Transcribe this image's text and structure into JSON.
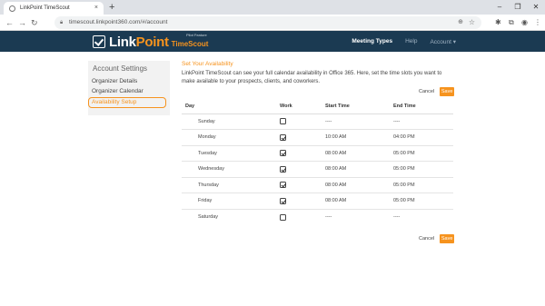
{
  "browser": {
    "tab_title": "LinkPoint TimeScout",
    "tab_close": "×",
    "new_tab": "+",
    "url": "timescout.linkpoint360.com/#/account",
    "window_controls": [
      "–",
      "❐",
      "✕"
    ]
  },
  "app": {
    "logo_main": "Link",
    "logo_accent": "Point",
    "logo_sub": "TimeScout",
    "logo_tag": "Pilot Feature",
    "nav": [
      "Meeting Types",
      "Help",
      "Account ▾"
    ]
  },
  "sidebar": {
    "title": "Account Settings",
    "items": [
      "Organizer Details",
      "Organizer Calendar",
      "Availability Setup"
    ]
  },
  "main": {
    "heading": "Set Your Availability",
    "description": "LinkPoint TimeScout can see your full calendar availability in Office 365. Here, set the time slots you want to make available to your prospects, clients, and coworkers.",
    "cancel_label": "Cancel",
    "save_label": "Save",
    "columns": [
      "Day",
      "Work",
      "Start Time",
      "End Time"
    ],
    "rows": [
      {
        "day": "Sunday",
        "work": false,
        "start": "----",
        "end": "----"
      },
      {
        "day": "Monday",
        "work": true,
        "start": "10:00 AM",
        "end": "04:00 PM"
      },
      {
        "day": "Tuesday",
        "work": true,
        "start": "08:00 AM",
        "end": "05:00 PM"
      },
      {
        "day": "Wednesday",
        "work": true,
        "start": "08:00 AM",
        "end": "05:00 PM"
      },
      {
        "day": "Thursday",
        "work": true,
        "start": "08:00 AM",
        "end": "05:00 PM"
      },
      {
        "day": "Friday",
        "work": true,
        "start": "08:00 AM",
        "end": "05:00 PM"
      },
      {
        "day": "Saturday",
        "work": false,
        "start": "----",
        "end": "----"
      }
    ]
  },
  "colors": {
    "header_bg": "#1b3a52",
    "accent": "#f6931e"
  }
}
